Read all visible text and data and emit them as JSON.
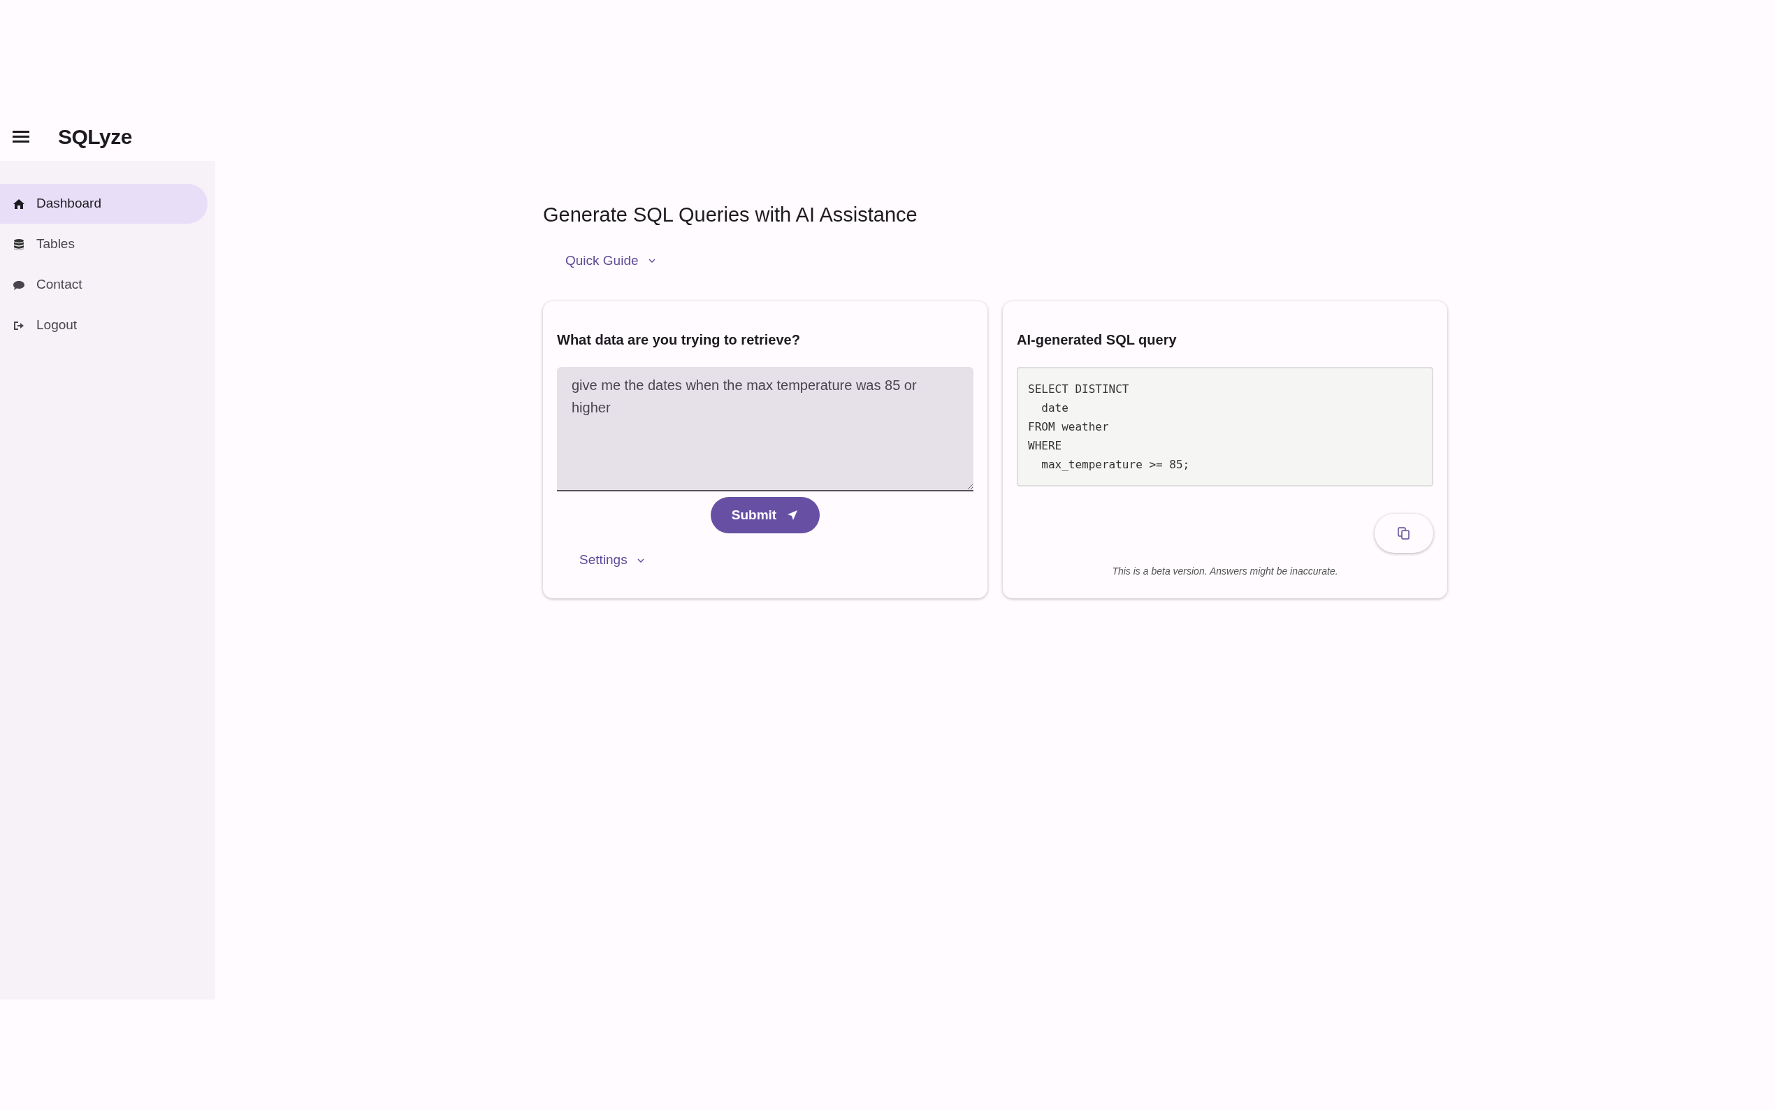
{
  "app": {
    "title": "SQLyze"
  },
  "sidebar": {
    "items": [
      {
        "label": "Dashboard",
        "selected": true
      },
      {
        "label": "Tables",
        "selected": false
      },
      {
        "label": "Contact",
        "selected": false
      },
      {
        "label": "Logout",
        "selected": false
      }
    ]
  },
  "main": {
    "title": "Generate SQL Queries with AI Assistance",
    "quick_guide": {
      "label": "Quick Guide",
      "expanded": false
    },
    "input_card": {
      "heading": "What data are you trying to retrieve?",
      "query": "give me the dates when the max temperature was 85 or higher",
      "submit": "Submit",
      "settings": {
        "label": "Settings",
        "expanded": false
      }
    },
    "output_card": {
      "heading": "AI-generated SQL query",
      "sql_lines": [
        "SELECT DISTINCT",
        "  date",
        "FROM weather",
        "WHERE",
        "  max_temperature >= 85;"
      ],
      "note": "This is a beta version. Answers might be inaccurate."
    }
  }
}
